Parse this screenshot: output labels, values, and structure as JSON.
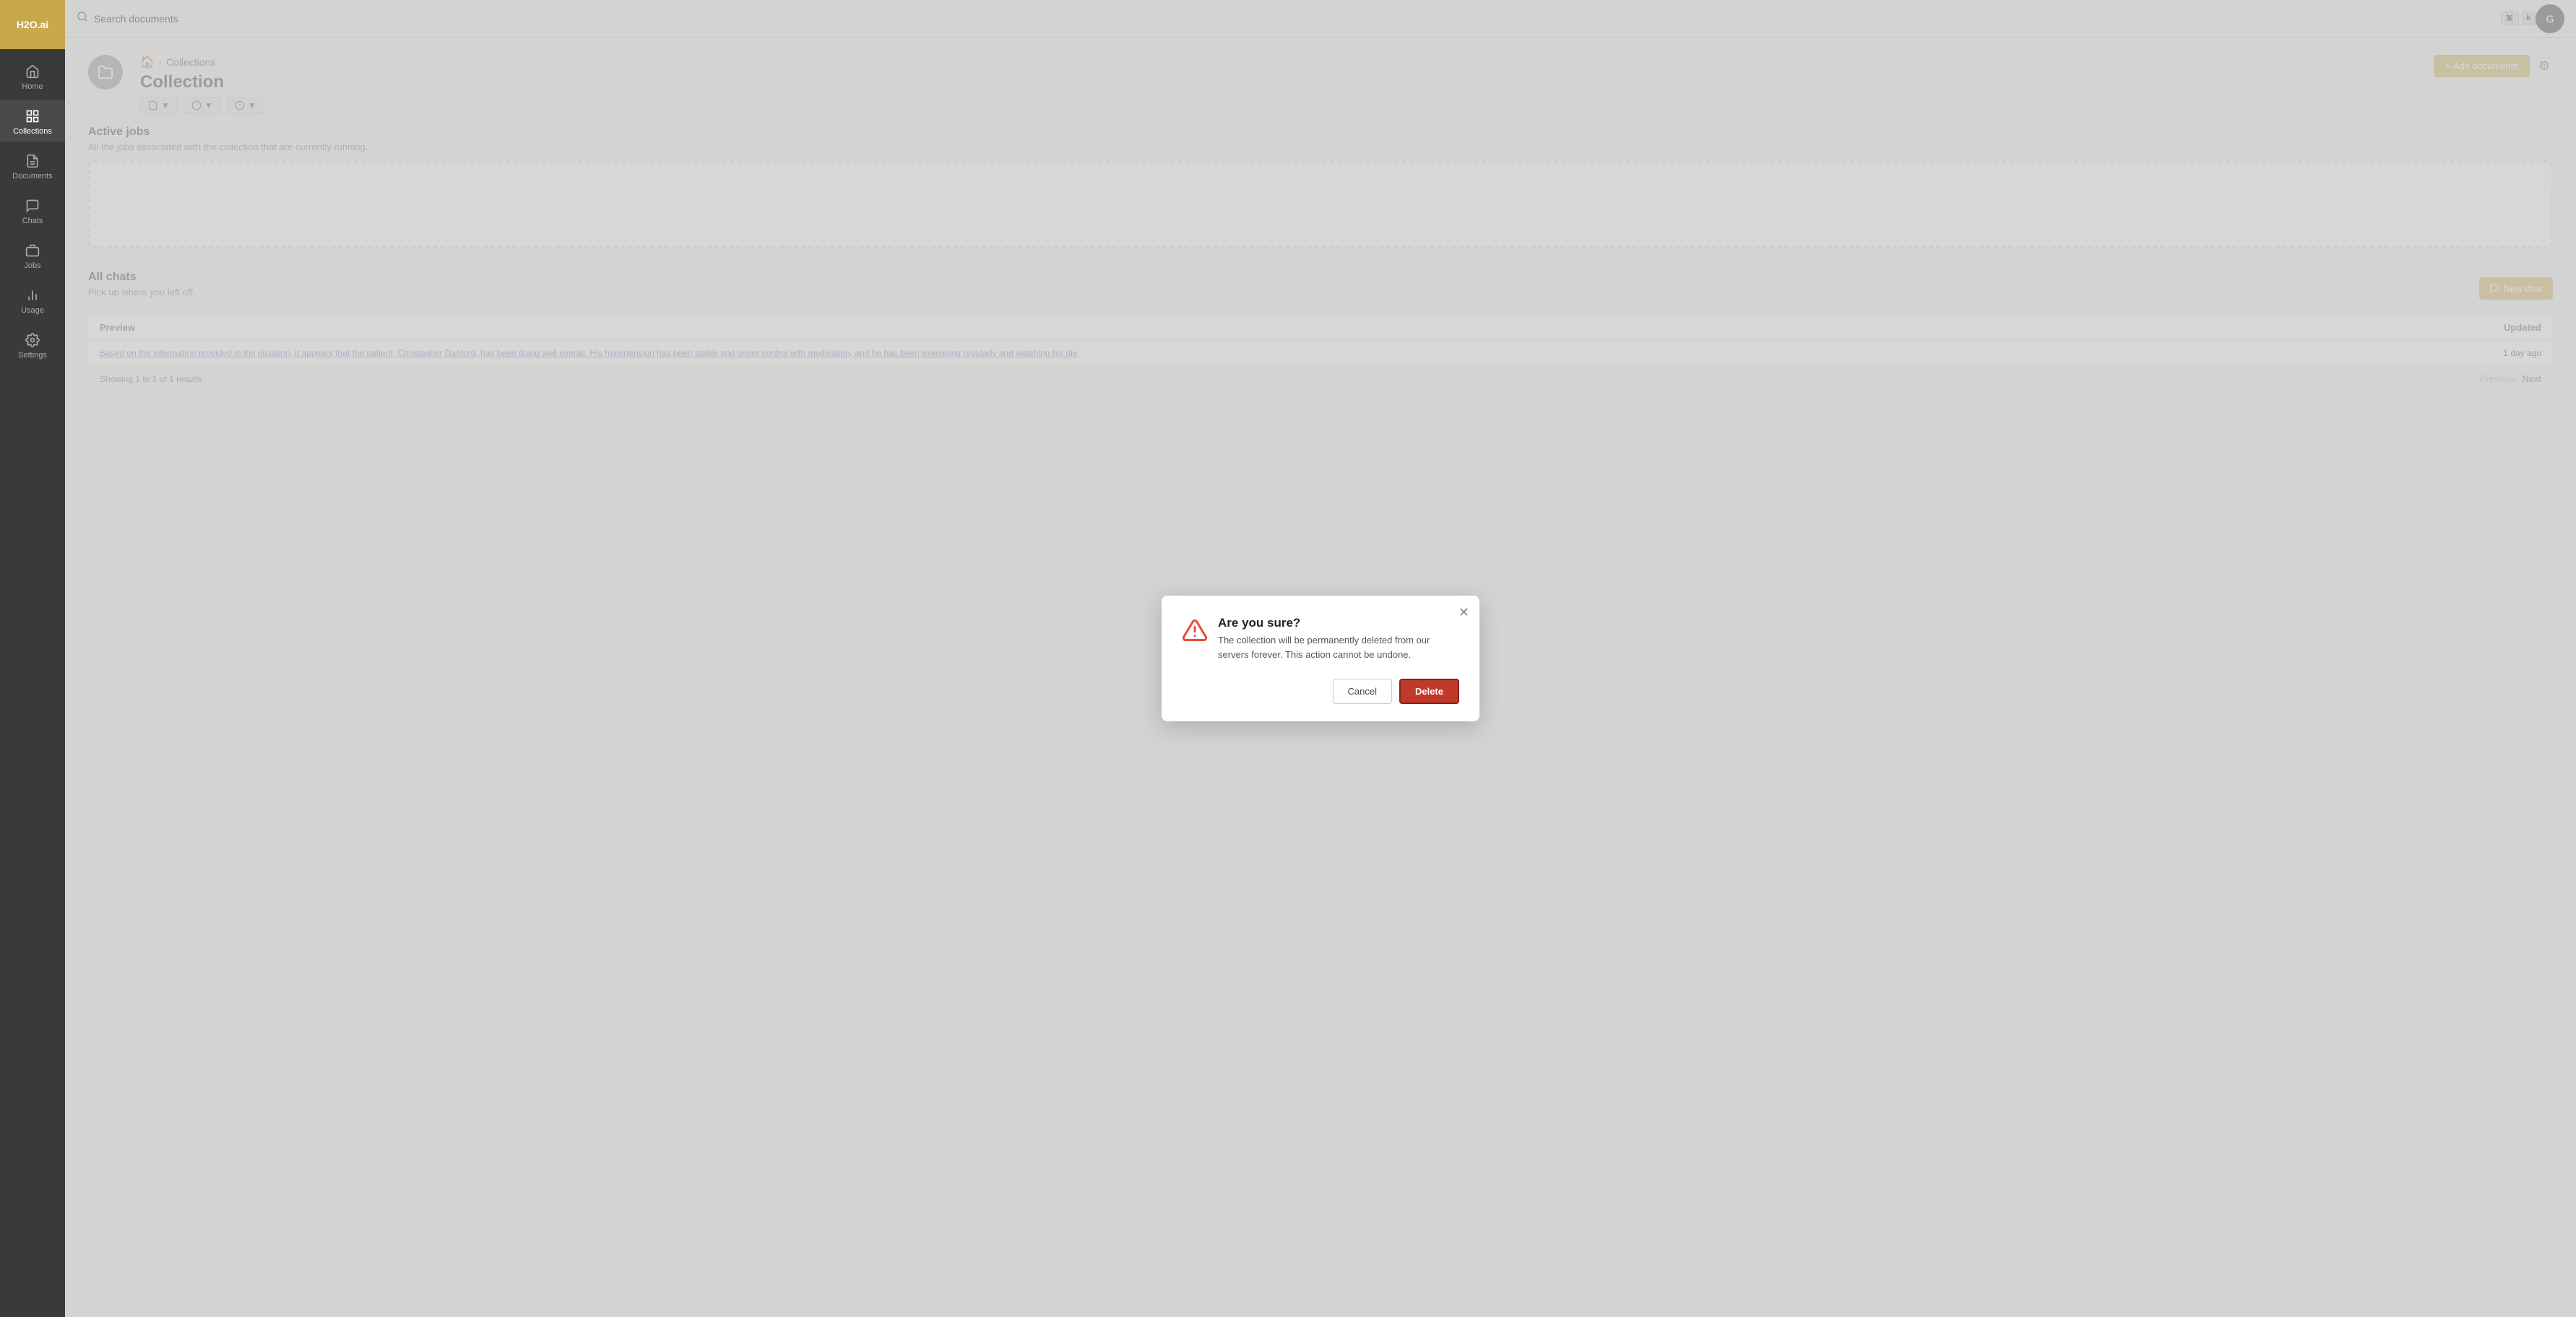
{
  "app": {
    "logo": "H2O.ai"
  },
  "sidebar": {
    "items": [
      {
        "id": "home",
        "label": "Home",
        "icon": "home-icon",
        "active": false
      },
      {
        "id": "collections",
        "label": "Collections",
        "icon": "collections-icon",
        "active": true
      },
      {
        "id": "documents",
        "label": "Documents",
        "icon": "documents-icon",
        "active": false
      },
      {
        "id": "chats",
        "label": "Chats",
        "icon": "chats-icon",
        "active": false
      },
      {
        "id": "jobs",
        "label": "Jobs",
        "icon": "jobs-icon",
        "active": false
      },
      {
        "id": "usage",
        "label": "Usage",
        "icon": "usage-icon",
        "active": false
      },
      {
        "id": "settings",
        "label": "Settings",
        "icon": "settings-icon",
        "active": false
      }
    ]
  },
  "topbar": {
    "search_placeholder": "Search documents",
    "kbd1": "⌘",
    "kbd2": "k",
    "user_initial": "G"
  },
  "breadcrumb": {
    "home_icon": "🏠",
    "separator": "›",
    "parent": "Collections",
    "current": ""
  },
  "collection": {
    "title": "Collection",
    "actions": [
      {
        "label": "▼",
        "id": "action1"
      },
      {
        "label": "▼",
        "id": "action2"
      },
      {
        "label": "▼",
        "id": "action3"
      }
    ],
    "add_docs_label": "+ Add documents",
    "settings_icon": "⚙"
  },
  "active_jobs": {
    "title": "Active jobs",
    "subtitle": "All the jobs associated with the collection that are currently running."
  },
  "all_chats": {
    "title": "All chats",
    "subtitle": "Pick up where you left off.",
    "new_chat_label": "New chat",
    "table": {
      "headers": [
        "Preview",
        "Updated"
      ],
      "rows": [
        {
          "preview": "Based on the information provided in the dictation, it appears that the patient, Christopher Danford, has been doing well overall. His hypertension has been stable and under control with medication, and he has been exercising regularly and watching his die",
          "updated": "1 day ago"
        }
      ]
    },
    "pagination": {
      "showing": "Showing 1 to 1 of 1 results",
      "previous": "Previous",
      "next": "Next"
    }
  },
  "modal": {
    "title": "Are you sure?",
    "body": "The collection will be permanently deleted from our servers forever. This action cannot be undone.",
    "cancel_label": "Cancel",
    "delete_label": "Delete"
  }
}
